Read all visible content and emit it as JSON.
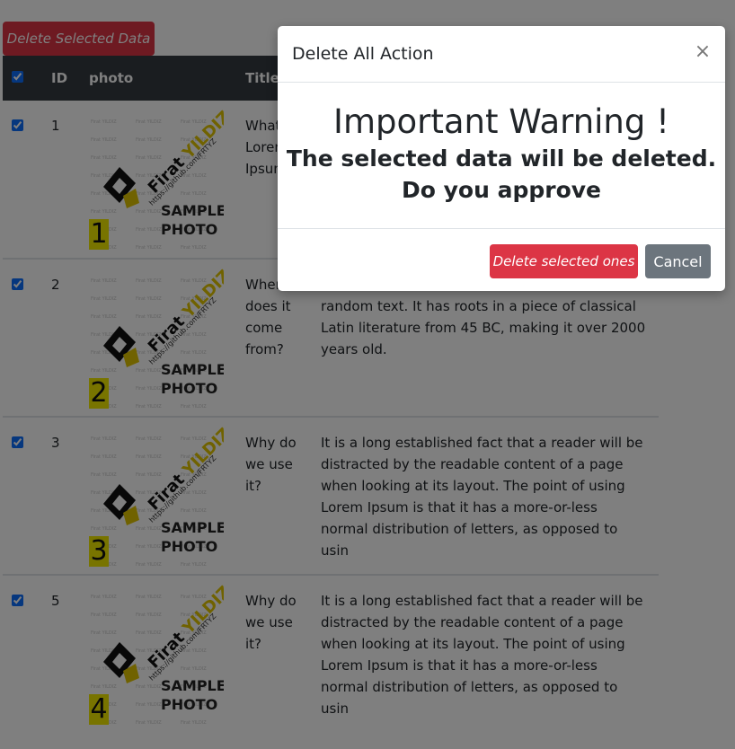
{
  "toolbar": {
    "delete_selected_label": "Delete Selected Data"
  },
  "table": {
    "headers": {
      "id": "ID",
      "photo": "photo",
      "title": "Title"
    },
    "select_all_checked": true,
    "rows": [
      {
        "checked": true,
        "id": "1",
        "title": "What is Lorem Ipsum?",
        "description": "",
        "photo_number": "1"
      },
      {
        "checked": true,
        "id": "2",
        "title": "Where does it come from?",
        "description": "random text. It has roots in a piece of classical Latin literature from 45 BC, making it over 2000 years old.",
        "photo_number": "2"
      },
      {
        "checked": true,
        "id": "3",
        "title": "Why do we use it?",
        "description": "It is a long established fact that a reader will be distracted by the readable content of a page when looking at its layout. The point of using Lorem Ipsum is that it has a more-or-less normal distribution of letters, as opposed to usin",
        "photo_number": "3"
      },
      {
        "checked": true,
        "id": "5",
        "title": "Why do we use it?",
        "description": "It is a long established fact that a reader will be distracted by the readable content of a page when looking at its layout. The point of using Lorem Ipsum is that it has a more-or-less normal distribution of letters, as opposed to usin",
        "photo_number": "4"
      }
    ]
  },
  "photo": {
    "brand_part1": "Firat ",
    "brand_part2": "YILDIZ",
    "url": "https://github.com/FRTYZ",
    "sample_line1": "SAMPLE",
    "sample_line2": "PHOTO",
    "watermark": "Firat YILDIZ"
  },
  "modal": {
    "title": "Delete All Action",
    "close_symbol": "×",
    "warning_title": "Important Warning !",
    "warning_line1": "The selected data will be deleted.",
    "warning_line2": "Do you approve",
    "confirm_label": "Delete selected ones",
    "cancel_label": "Cancel"
  },
  "colors": {
    "danger": "#dc3545",
    "secondary": "#6c757d",
    "table_header": "#343a40",
    "photo_badge": "#f0e800"
  }
}
